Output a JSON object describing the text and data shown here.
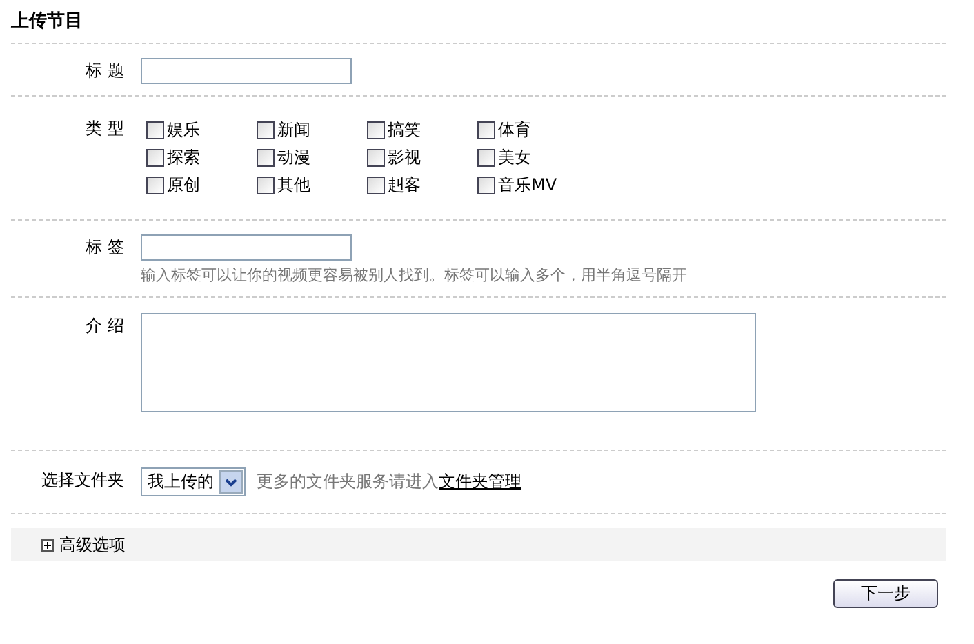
{
  "title": "上传节目",
  "fields": [
    {
      "kind": "text",
      "label": "标 题"
    },
    {
      "kind": "checkboxes",
      "label": "类 型",
      "options": [
        {
          "label": "娱乐",
          "checked": false
        },
        {
          "label": "新闻",
          "checked": false
        },
        {
          "label": "搞笑",
          "checked": false
        },
        {
          "label": "体育",
          "checked": false
        },
        {
          "label": "探索",
          "checked": false
        },
        {
          "label": "动漫",
          "checked": false
        },
        {
          "label": "影视",
          "checked": false
        },
        {
          "label": "美女",
          "checked": false
        },
        {
          "label": "原创",
          "checked": false
        },
        {
          "label": "其他",
          "checked": false
        },
        {
          "label": "赳客",
          "checked": false
        },
        {
          "label": "音乐MV",
          "checked": false
        }
      ]
    },
    {
      "kind": "text",
      "label": "标 签",
      "hint": "输入标签可以让你的视频更容易被别人找到。标签可以输入多个，用半角逗号隔开"
    },
    {
      "kind": "textarea",
      "label": "介 绍"
    },
    {
      "kind": "select",
      "label": "选择文件夹",
      "value": "我上传的",
      "note": "更多的文件夹服务请进入",
      "link": "文件夹管理"
    }
  ],
  "advanced": {
    "label": "高级选项",
    "expanded": false
  },
  "next_button": "下一步"
}
